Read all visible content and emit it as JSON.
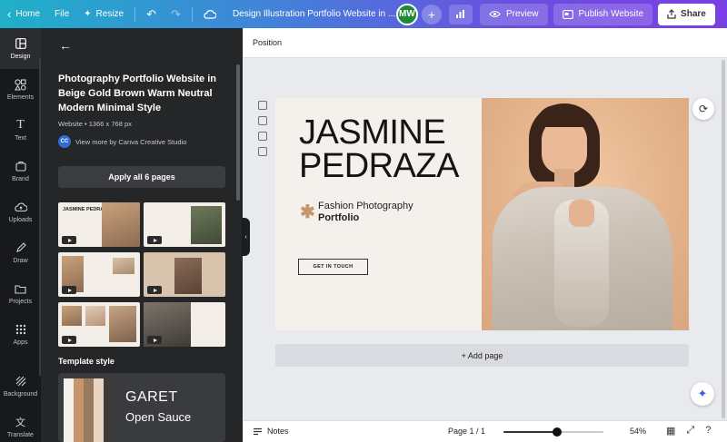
{
  "topbar": {
    "home_label": "Home",
    "file_label": "File",
    "resize_label": "Resize",
    "document_title": "Design Illustration Portfolio Website in ...",
    "avatar_initials": "MW",
    "preview_label": "Preview",
    "publish_label": "Publish Website",
    "share_label": "Share"
  },
  "rail": {
    "items": [
      {
        "label": "Design",
        "icon": "layout-icon"
      },
      {
        "label": "Elements",
        "icon": "shapes-icon"
      },
      {
        "label": "Text",
        "icon": "text-icon"
      },
      {
        "label": "Brand",
        "icon": "brand-icon"
      },
      {
        "label": "Uploads",
        "icon": "cloud-upload-icon"
      },
      {
        "label": "Draw",
        "icon": "pen-icon"
      },
      {
        "label": "Projects",
        "icon": "folder-icon"
      },
      {
        "label": "Apps",
        "icon": "grid-icon"
      }
    ],
    "bottom_items": [
      {
        "label": "Background",
        "icon": "background-icon"
      },
      {
        "label": "Translate",
        "icon": "translate-icon"
      }
    ]
  },
  "panel": {
    "title": "Photography Portfolio Website in Beige Gold Brown Warm Neutral Modern Minimal Style",
    "meta": "Website • 1366 x 768 px",
    "author_initials": "CC",
    "author_text": "View more by Canva Creative Studio",
    "apply_label": "Apply all 6 pages",
    "thumb1_name": "JASMINE PEDRAZA",
    "template_style_label": "Template style",
    "style_font1": "GARET",
    "style_font2": "Open Sauce",
    "swatches": [
      "#f4f1ec",
      "#c8946c",
      "#9a7a5e",
      "#e8d5c4",
      "#3d3a37"
    ]
  },
  "position_bar": {
    "label": "Position"
  },
  "page": {
    "name_line1": "JASMINE",
    "name_line2": "PEDRAZA",
    "tagline_line1": "Fashion Photography",
    "tagline_line2": "Portfolio",
    "cta_label": "GET IN TOUCH"
  },
  "canvas": {
    "add_page_label": "+ Add page"
  },
  "bottombar": {
    "notes_label": "Notes",
    "page_indicator": "Page 1 / 1",
    "zoom_label": "54%",
    "zoom_fraction": 0.54
  },
  "colors": {
    "accent": "#c8946c",
    "panel_bg": "#252627",
    "rail_bg": "#18191b"
  }
}
